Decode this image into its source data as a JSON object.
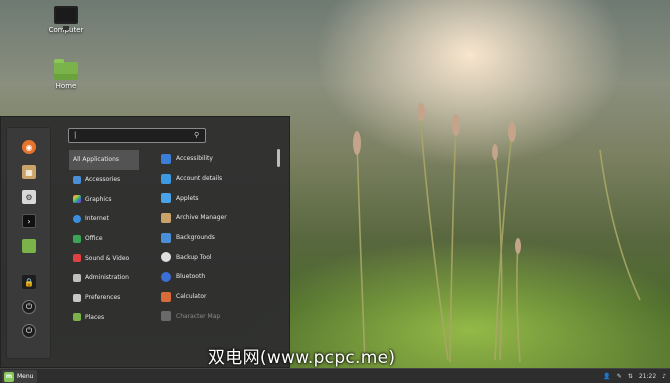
{
  "desktop": {
    "icons": [
      {
        "label": "Computer",
        "icon": "computer-icon"
      },
      {
        "label": "Home",
        "icon": "home-folder-icon"
      }
    ]
  },
  "menu": {
    "search": {
      "value": "|",
      "icon": "search-icon"
    },
    "favorites": [
      {
        "icon": "firefox-icon",
        "color": "#e8742c"
      },
      {
        "icon": "software-manager-icon",
        "color": "#c9a36a"
      },
      {
        "icon": "settings-icon",
        "color": "#d9d9d9"
      },
      {
        "icon": "terminal-icon",
        "color": "#111111"
      },
      {
        "icon": "files-icon",
        "color": "#7ab34a"
      },
      {
        "icon": "lock-screen-icon",
        "color": "#2a2a2a"
      },
      {
        "icon": "logout-icon",
        "color": "#2a2a2a"
      },
      {
        "icon": "shutdown-icon",
        "color": "#2a2a2a"
      }
    ],
    "categories": [
      {
        "label": "All Applications",
        "icon": "",
        "active": true
      },
      {
        "label": "Accessories",
        "icon": "accessories-icon",
        "color": "#4a90d9"
      },
      {
        "label": "Graphics",
        "icon": "graphics-icon",
        "color": "#d94ac2"
      },
      {
        "label": "Internet",
        "icon": "internet-icon",
        "color": "#3b8fe0"
      },
      {
        "label": "Office",
        "icon": "office-icon",
        "color": "#3aa655"
      },
      {
        "label": "Sound & Video",
        "icon": "sound-video-icon",
        "color": "#e04040"
      },
      {
        "label": "Administration",
        "icon": "administration-icon",
        "color": "#c0c0c0"
      },
      {
        "label": "Preferences",
        "icon": "preferences-icon",
        "color": "#c8c8c8"
      },
      {
        "label": "Places",
        "icon": "places-folder-icon",
        "color": "#7ab34a"
      }
    ],
    "apps": [
      {
        "label": "Accessibility",
        "icon": "accessibility-icon",
        "color": "#3b7fd6"
      },
      {
        "label": "Account details",
        "icon": "account-details-icon",
        "color": "#3b9ae0"
      },
      {
        "label": "Applets",
        "icon": "applets-icon",
        "color": "#4aa3e8"
      },
      {
        "label": "Archive Manager",
        "icon": "archive-manager-icon",
        "color": "#c9a36a"
      },
      {
        "label": "Backgrounds",
        "icon": "backgrounds-icon",
        "color": "#4a90d9"
      },
      {
        "label": "Backup Tool",
        "icon": "backup-tool-icon",
        "color": "#e0e0e0"
      },
      {
        "label": "Bluetooth",
        "icon": "bluetooth-icon",
        "color": "#3b6fd6"
      },
      {
        "label": "Calculator",
        "icon": "calculator-icon",
        "color": "#d96a3a"
      },
      {
        "label": "Character Map",
        "icon": "character-map-icon",
        "color": "#8a8a8a",
        "dim": true
      }
    ]
  },
  "watermark": "双电网(www.pcpc.me)",
  "taskbar": {
    "menu_label": "Menu",
    "clock": "21:22"
  }
}
